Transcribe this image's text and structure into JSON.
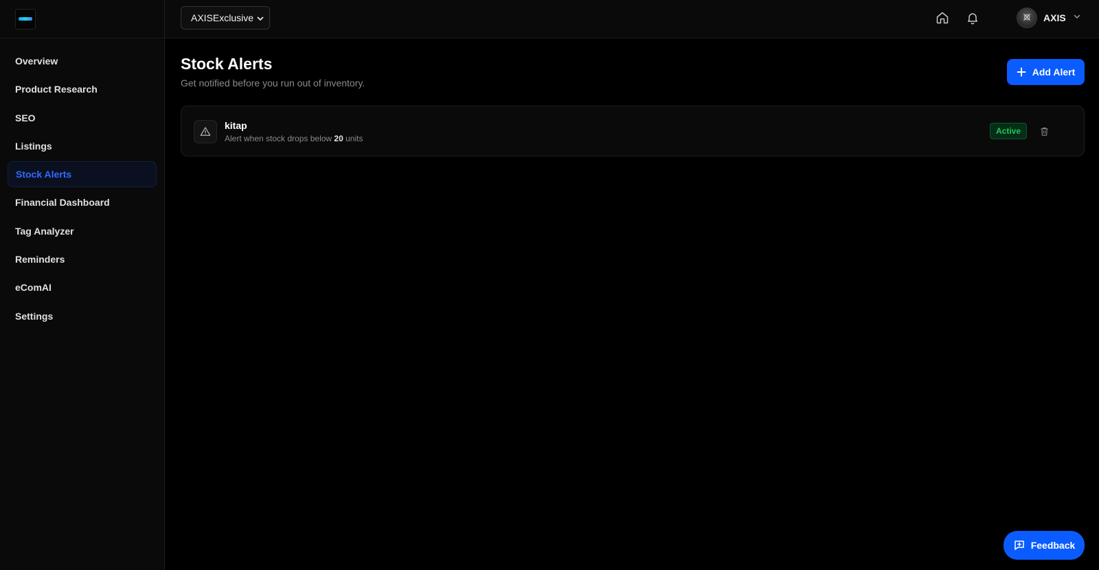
{
  "sidebar": {
    "items": [
      {
        "label": "Overview",
        "active": false
      },
      {
        "label": "Product Research",
        "active": false
      },
      {
        "label": "SEO",
        "active": false
      },
      {
        "label": "Listings",
        "active": false
      },
      {
        "label": "Stock Alerts",
        "active": true
      },
      {
        "label": "Financial Dashboard",
        "active": false
      },
      {
        "label": "Tag Analyzer",
        "active": false
      },
      {
        "label": "Reminders",
        "active": false
      },
      {
        "label": "eComAI",
        "active": false
      },
      {
        "label": "Settings",
        "active": false
      }
    ]
  },
  "header": {
    "store_select": {
      "selected": "AXISExclusive"
    },
    "icons": [
      "home-icon",
      "bell-icon"
    ],
    "user": {
      "name": "AXIS"
    }
  },
  "main": {
    "title": "Stock Alerts",
    "subtitle": "Get notified before you run out of inventory.",
    "add_button_label": "Add Alert",
    "alerts": [
      {
        "name": "kitap",
        "desc_prefix": "Alert when stock drops below",
        "threshold": "20",
        "desc_suffix": "units",
        "status": "Active"
      }
    ]
  },
  "feedback_button_label": "Feedback",
  "colors": {
    "accent": "#0a5cff",
    "active_nav_text": "#2f6bff",
    "status_active": "#22c55e",
    "background": "#000000"
  }
}
